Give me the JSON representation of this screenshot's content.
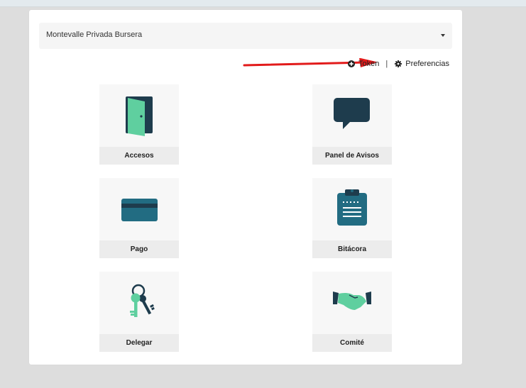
{
  "selector": {
    "value": "Montevalle Privada Bursera"
  },
  "links": {
    "token": "Token",
    "separator": "|",
    "preferences": "Preferencias"
  },
  "tiles": [
    {
      "label": "Accesos",
      "icon": "door-icon"
    },
    {
      "label": "Panel de Avisos",
      "icon": "speech-bubble-icon"
    },
    {
      "label": "Pago",
      "icon": "credit-card-icon"
    },
    {
      "label": "Bitácora",
      "icon": "clipboard-icon"
    },
    {
      "label": "Delegar",
      "icon": "keys-icon"
    },
    {
      "label": "Comité",
      "icon": "handshake-icon"
    }
  ],
  "colors": {
    "teal_dark": "#1e3c4d",
    "teal": "#226c82",
    "mint": "#5fcf9f",
    "annotation_arrow": "#e21b1b"
  }
}
